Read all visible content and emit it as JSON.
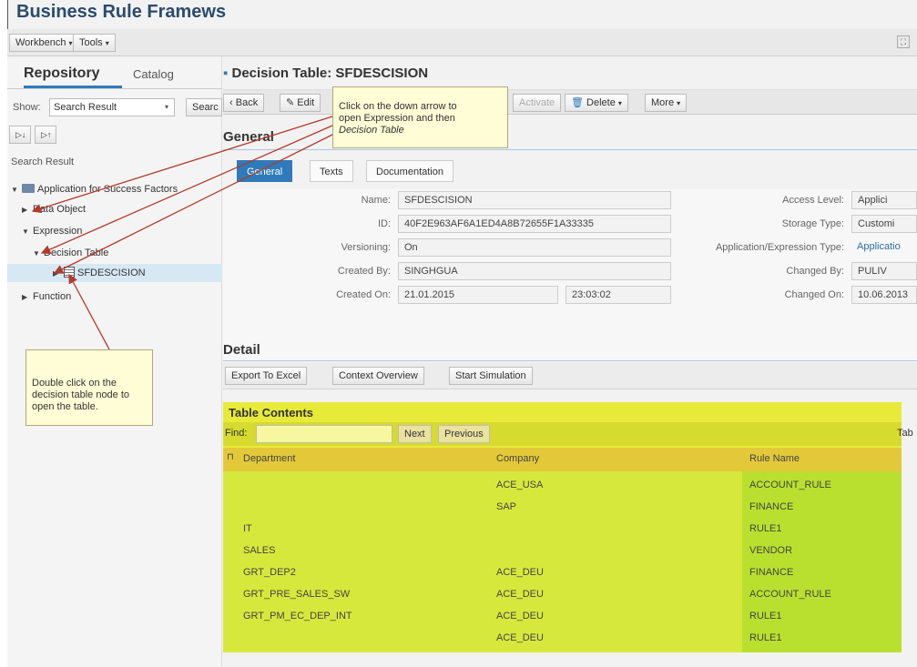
{
  "app": {
    "title": "Business Rule Framews"
  },
  "topbar": {
    "workbench": "Workbench",
    "tools": "Tools"
  },
  "left": {
    "tab_repository": "Repository",
    "tab_catalog": "Catalog",
    "show_label": "Show:",
    "show_value": "Search Result",
    "search_btn": "Searc",
    "search_result_label": "Search Result",
    "tree": [
      {
        "label": "Application for Success Factors"
      },
      {
        "label": "Data Object"
      },
      {
        "label": "Expression"
      },
      {
        "label": "Decision Table"
      },
      {
        "label": "SFDESCISION"
      },
      {
        "label": "Function"
      }
    ]
  },
  "main": {
    "title": "Decision Table: SFDESCISION",
    "toolbar": {
      "back": "Back",
      "edit": "Edit",
      "activate": "Activate",
      "delete": "Delete",
      "more": "More"
    },
    "general_heading": "General",
    "tabs": [
      "General",
      "Texts",
      "Documentation"
    ],
    "fields": {
      "name_label": "Name:",
      "name_value": "SFDESCISION",
      "id_label": "ID:",
      "id_value": "40F2E963AF6A1ED4A8B72655F1A33335",
      "versioning_label": "Versioning:",
      "versioning_value": "On",
      "created_by_label": "Created By:",
      "created_by_value": "SINGHGUA",
      "created_on_label": "Created On:",
      "created_on_date": "21.01.2015",
      "created_on_time": "23:03:02",
      "access_level_label": "Access Level:",
      "access_level_value": "Applici",
      "storage_type_label": "Storage Type:",
      "storage_type_value": "Customi",
      "app_expr_type_label": "Application/Expression Type:",
      "app_expr_type_value": "Applicatio",
      "changed_by_label": "Changed By:",
      "changed_by_value": "PULIV",
      "changed_on_label": "Changed On:",
      "changed_on_value": "10.06.2013"
    },
    "detail_heading": "Detail",
    "detail_buttons": {
      "export": "Export To Excel",
      "context": "Context Overview",
      "simulation": "Start Simulation"
    },
    "table": {
      "title": "Table Contents",
      "find_label": "Find:",
      "next": "Next",
      "previous": "Previous",
      "right_label": "Tab",
      "columns": [
        "Department",
        "Company",
        "Rule Name"
      ],
      "rows": [
        [
          "",
          "ACE_USA",
          "ACCOUNT_RULE"
        ],
        [
          "",
          "SAP",
          "FINANCE"
        ],
        [
          "IT",
          "",
          "RULE1"
        ],
        [
          "SALES",
          "",
          "VENDOR"
        ],
        [
          "GRT_DEP2",
          "ACE_DEU",
          "FINANCE"
        ],
        [
          "GRT_PRE_SALES_SW",
          "ACE_DEU",
          "ACCOUNT_RULE"
        ],
        [
          "GRT_PM_EC_DEP_INT",
          "ACE_DEU",
          "RULE1"
        ],
        [
          "",
          "ACE_DEU",
          "RULE1"
        ]
      ]
    }
  },
  "callouts": {
    "top_line1": "Click on the down arrow to",
    "top_line2": "open Expression and then",
    "top_line3": "Decision Table",
    "bottom_line1": "Double click on the",
    "bottom_line2": "decision table node to",
    "bottom_line3": "open the table."
  },
  "colors": {
    "accent": "#2f7ab9",
    "highlight": "#e8ea3a",
    "arrow": "#b23a2a"
  }
}
